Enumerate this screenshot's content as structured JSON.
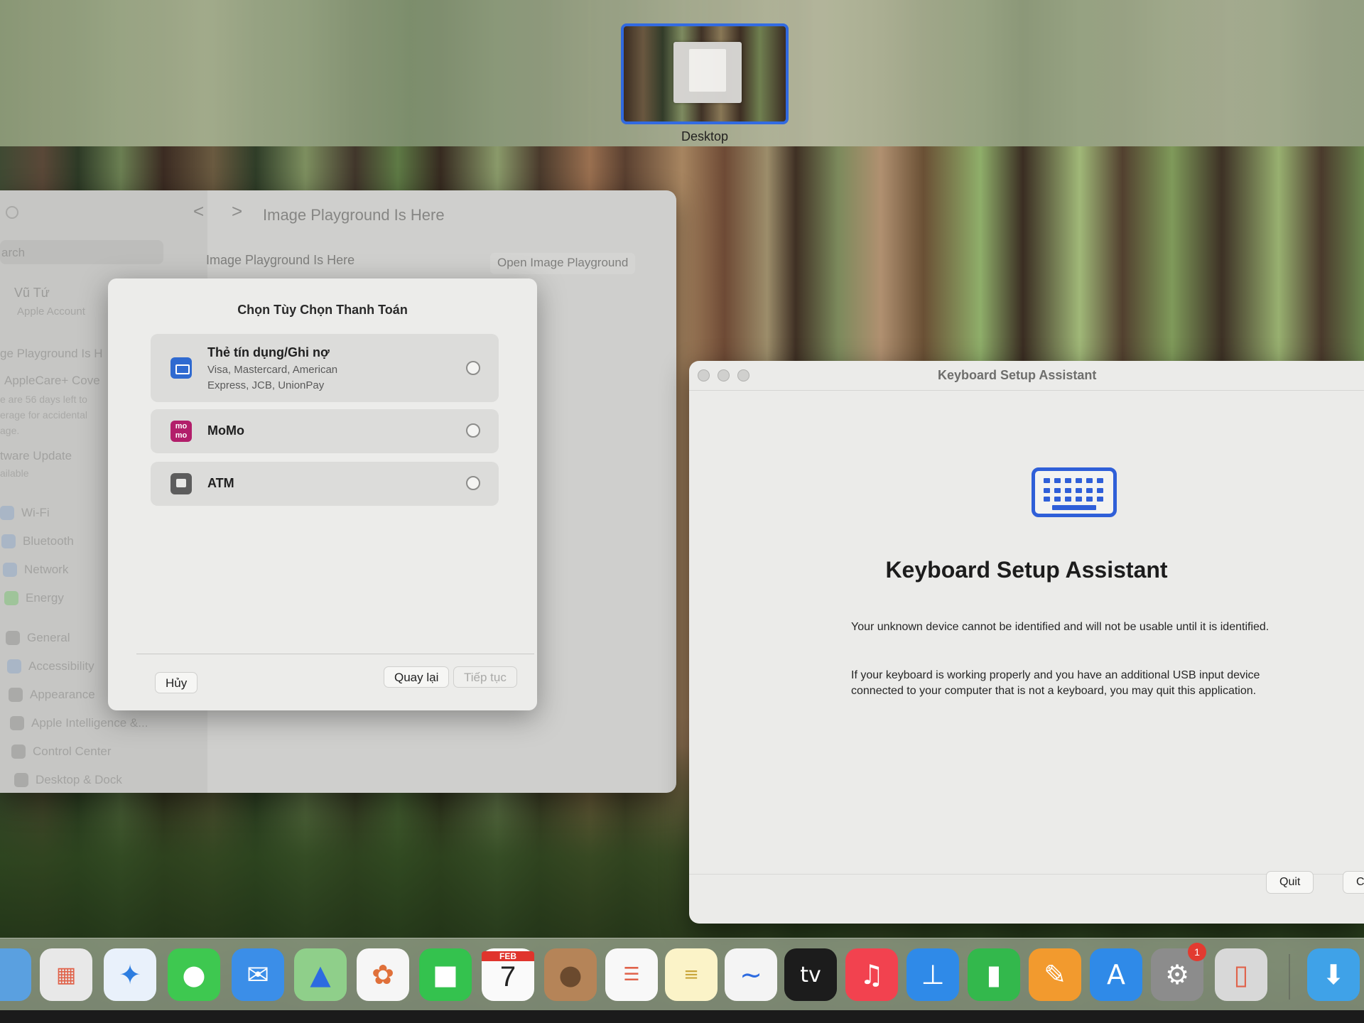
{
  "spaces": {
    "desktop_label": "Desktop"
  },
  "settings": {
    "search_placeholder": "arch",
    "profile_name": "Vũ Tứ",
    "profile_sub": "Apple Account",
    "sidebar_playground": "ge Playground Is H",
    "applecare": "AppleCare+ Cove",
    "applecare_l1": "e are 56 days left to",
    "applecare_l2": "erage for accidental",
    "applecare_l3": "age.",
    "software_update": "tware Update",
    "software_update_sub": "ailable",
    "items": [
      {
        "label": "Wi-Fi"
      },
      {
        "label": "Bluetooth"
      },
      {
        "label": "Network"
      },
      {
        "label": "Energy"
      },
      {
        "label": "General"
      },
      {
        "label": "Accessibility"
      },
      {
        "label": "Appearance"
      },
      {
        "label": "Apple Intelligence &..."
      },
      {
        "label": "Control Center"
      },
      {
        "label": "Desktop & Dock"
      }
    ],
    "toolbar_back": "<",
    "toolbar_forward": ">",
    "title": "Image Playground Is Here",
    "row_label": "Image Playground Is Here",
    "open_button": "Open Image Playground"
  },
  "payment_sheet": {
    "title": "Chọn Tùy Chọn Thanh Toán",
    "options": [
      {
        "name": "Thẻ tín dụng/Ghi nợ",
        "desc": "Visa, Mastercard, American Express, JCB, UnionPay"
      },
      {
        "name": "MoMo",
        "icon_text": "mo mo"
      },
      {
        "name": "ATM"
      }
    ],
    "cancel": "Hủy",
    "back": "Quay lại",
    "continue": "Tiếp tục"
  },
  "keyboard_assistant": {
    "window_title": "Keyboard Setup Assistant",
    "heading": "Keyboard Setup Assistant",
    "para1": "Your unknown device cannot be identified and will not be usable until it is identified.",
    "para2": "If your keyboard is working properly and you have an additional USB input device connected to your computer that is not a keyboard, you may quit this application.",
    "quit": "Quit",
    "continue_partial": "C"
  },
  "dock": {
    "calendar_month": "FEB",
    "calendar_day": "7",
    "appletv_label": "tv",
    "settings_badge": "1"
  }
}
